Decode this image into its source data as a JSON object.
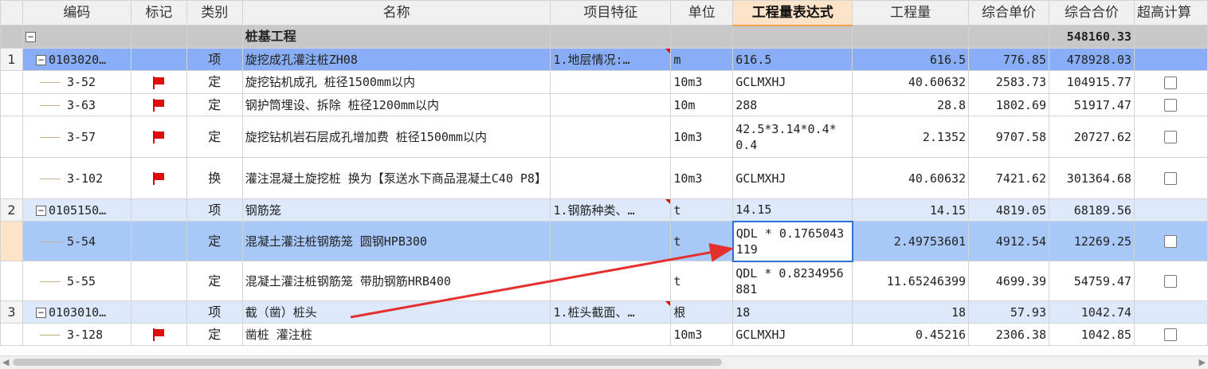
{
  "headers": [
    "编码",
    "标记",
    "类别",
    "名称",
    "项目特征",
    "单位",
    "工程量表达式",
    "工程量",
    "综合单价",
    "综合合价",
    "超高计算"
  ],
  "root": {
    "name": "桩基工程",
    "total": "548160.33"
  },
  "rows": [
    {
      "no": "1",
      "code": "0103020…",
      "type": "项",
      "name": "旋挖成孔灌注桩ZH08",
      "feature": "1.地层情况:…",
      "unit": "m",
      "expr": "616.5",
      "qty": "616.5",
      "price": "776.85",
      "total": "478928.03"
    },
    {
      "code": "3-52",
      "type": "定",
      "name": "旋挖钻机成孔 桩径1500mm以内",
      "unit": "10m3",
      "expr": "GCLMXHJ",
      "qty": "40.60632",
      "price": "2583.73",
      "total": "104915.77"
    },
    {
      "code": "3-63",
      "type": "定",
      "name": "钢护筒埋设、拆除 桩径1200mm以内",
      "unit": "10m",
      "expr": "288",
      "qty": "28.8",
      "price": "1802.69",
      "total": "51917.47"
    },
    {
      "code": "3-57",
      "type": "定",
      "name": "旋挖钻机岩石层成孔增加费 桩径1500mm以内",
      "unit": "10m3",
      "expr": "42.5*3.14*0.4*0.4",
      "qty": "2.1352",
      "price": "9707.58",
      "total": "20727.62"
    },
    {
      "code": "3-102",
      "type": "换",
      "name": "灌注混凝土旋挖桩  换为【泵送水下商品混凝土C40 P8】",
      "unit": "10m3",
      "expr": "GCLMXHJ",
      "qty": "40.60632",
      "price": "7421.62",
      "total": "301364.68"
    },
    {
      "no": "2",
      "code": "0105150…",
      "type": "项",
      "name": "钢筋笼",
      "feature": "1.钢筋种类、…",
      "unit": "t",
      "expr": "14.15",
      "qty": "14.15",
      "price": "4819.05",
      "total": "68189.56"
    },
    {
      "code": "5-54",
      "type": "定",
      "name": "混凝土灌注桩钢筋笼 圆钢HPB300",
      "unit": "t",
      "expr": "QDL * 0.1765043119",
      "qty": "2.49753601",
      "price": "4912.54",
      "total": "12269.25"
    },
    {
      "code": "5-55",
      "type": "定",
      "name": "混凝土灌注桩钢筋笼 带肋钢筋HRB400",
      "unit": "t",
      "expr": "QDL * 0.8234956881",
      "qty": "11.65246399",
      "price": "4699.39",
      "total": "54759.47"
    },
    {
      "no": "3",
      "code": "0103010…",
      "type": "项",
      "name": "截（凿）桩头",
      "feature": "1.桩头截面、…",
      "unit": "根",
      "expr": "18",
      "qty": "18",
      "price": "57.93",
      "total": "1042.74"
    },
    {
      "code": "3-128",
      "type": "定",
      "name": "凿桩 灌注桩",
      "unit": "10m3",
      "expr": "GCLMXHJ",
      "qty": "0.45216",
      "price": "2306.38",
      "total": "1042.85"
    }
  ],
  "colors": {
    "root_bg": "#c8c8c8",
    "selected_bg": "#8aaef5",
    "item_bg": "#dde8fb",
    "current_bg": "#a8c8f8",
    "flag": "#e10d0d",
    "annotation_arrow": "#e53030",
    "active_border": "#2f6fd0"
  },
  "icons": {
    "flag": "red-flag-icon",
    "expand": "collapse-minus-icon",
    "checkbox": "checkbox-icon"
  }
}
